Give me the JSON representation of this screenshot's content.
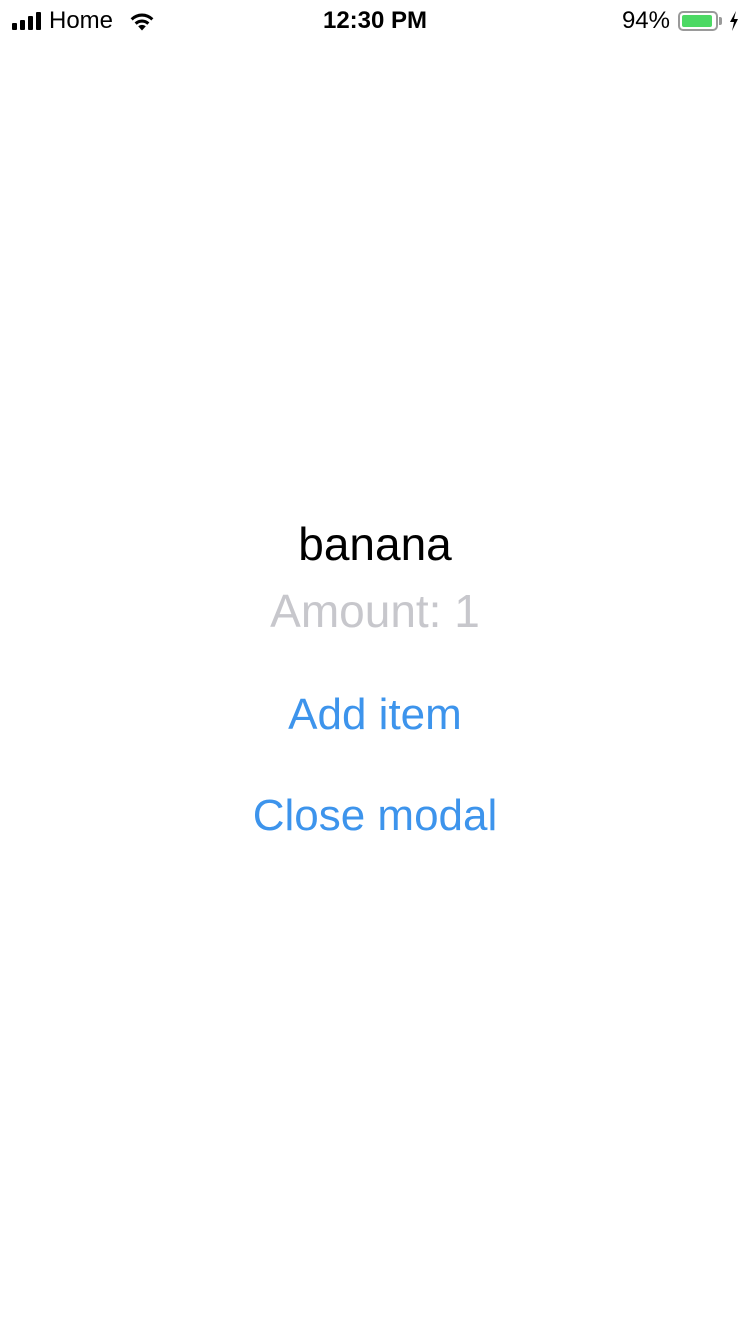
{
  "status_bar": {
    "carrier": "Home",
    "time": "12:30 PM",
    "battery_percent_label": "94%",
    "battery_level": 0.94,
    "signal_icon": "cellular-signal-icon",
    "wifi_icon": "wifi-icon",
    "battery_icon": "battery-icon",
    "charging_icon": "charging-bolt-icon"
  },
  "modal": {
    "item_name": "banana",
    "amount_label": "Amount: 1",
    "add_item_label": "Add item",
    "close_modal_label": "Close modal"
  },
  "colors": {
    "background": "#ffffff",
    "primary_text": "#000000",
    "secondary_text": "#c7c7cc",
    "link": "#3d94ec",
    "battery_fill": "#4cd964"
  }
}
